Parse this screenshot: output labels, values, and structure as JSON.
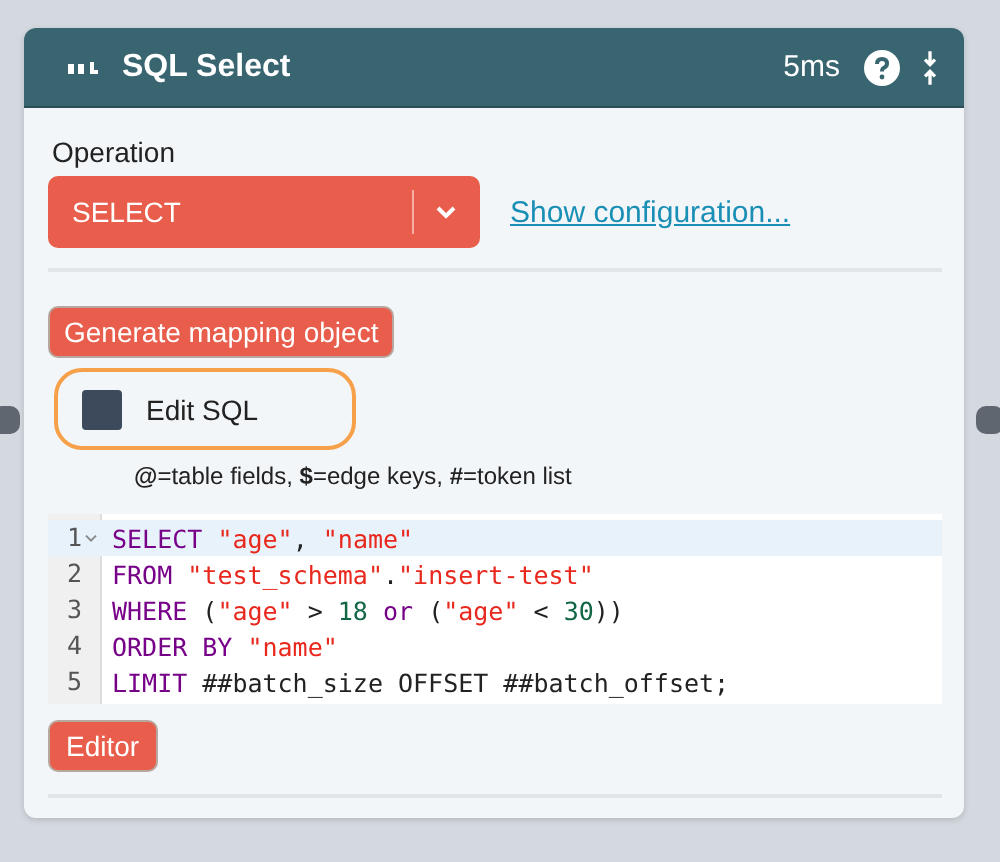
{
  "node": {
    "title": "SQL Select",
    "timing": "5ms"
  },
  "operation": {
    "label": "Operation",
    "value": "SELECT",
    "link": "Show configuration..."
  },
  "generate_button": "Generate mapping object",
  "edit_sql": {
    "label": "Edit SQL",
    "checked": true,
    "focused": true
  },
  "hint": "**@**=table fields, **$**=edge keys, **#**=token list",
  "code": [
    {
      "number": "1",
      "active": true,
      "foldable": true,
      "tokens": [
        {
          "kind": "keyword",
          "text": "SELECT "
        },
        {
          "kind": "string",
          "text": "\"age\""
        },
        {
          "kind": "plain",
          "text": ", "
        },
        {
          "kind": "string",
          "text": "\"name\""
        }
      ]
    },
    {
      "number": "2",
      "active": false,
      "foldable": false,
      "tokens": [
        {
          "kind": "keyword",
          "text": "FROM "
        },
        {
          "kind": "string",
          "text": "\"test_schema\""
        },
        {
          "kind": "plain",
          "text": "."
        },
        {
          "kind": "string",
          "text": "\"insert-test\""
        }
      ]
    },
    {
      "number": "3",
      "active": false,
      "foldable": false,
      "tokens": [
        {
          "kind": "keyword",
          "text": "WHERE "
        },
        {
          "kind": "plain",
          "text": "("
        },
        {
          "kind": "string",
          "text": "\"age\""
        },
        {
          "kind": "plain",
          "text": " > "
        },
        {
          "kind": "number",
          "text": "18"
        },
        {
          "kind": "keyword",
          "text": " or "
        },
        {
          "kind": "plain",
          "text": "("
        },
        {
          "kind": "string",
          "text": "\"age\""
        },
        {
          "kind": "plain",
          "text": " < "
        },
        {
          "kind": "number",
          "text": "30"
        },
        {
          "kind": "plain",
          "text": "))"
        }
      ]
    },
    {
      "number": "4",
      "active": false,
      "foldable": false,
      "tokens": [
        {
          "kind": "keyword",
          "text": "ORDER BY "
        },
        {
          "kind": "string",
          "text": "\"name\""
        }
      ]
    },
    {
      "number": "5",
      "active": false,
      "foldable": false,
      "tokens": [
        {
          "kind": "keyword",
          "text": "LIMIT "
        },
        {
          "kind": "plain",
          "text": "##batch_size OFFSET ##batch_offset;"
        }
      ]
    }
  ],
  "editor_button": "Editor"
}
